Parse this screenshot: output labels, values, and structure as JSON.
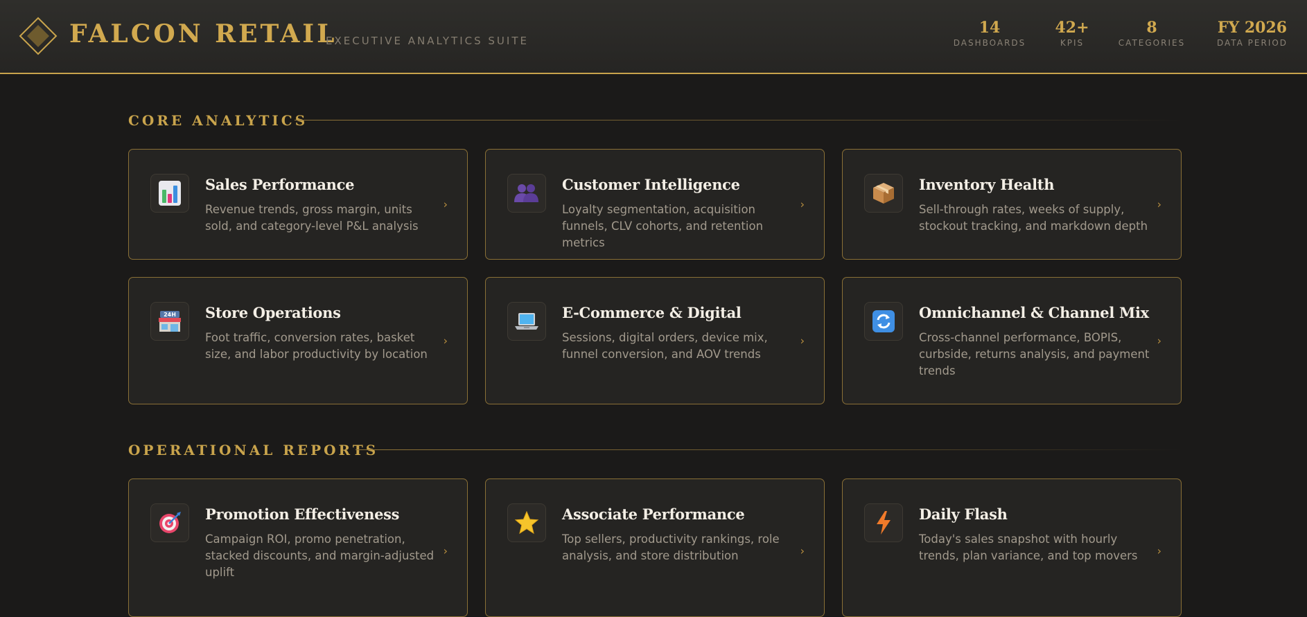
{
  "header": {
    "brand": "FALCON RETAIL",
    "subtitle": "EXECUTIVE ANALYTICS SUITE",
    "stats": [
      {
        "value": "14",
        "label": "DASHBOARDS"
      },
      {
        "value": "42+",
        "label": "KPIS"
      },
      {
        "value": "8",
        "label": "CATEGORIES"
      },
      {
        "value": "FY 2026",
        "label": "DATA PERIOD"
      }
    ]
  },
  "sections": [
    {
      "title": "CORE ANALYTICS",
      "cards": [
        {
          "icon": "bar-chart-icon",
          "title": "Sales Performance",
          "desc": "Revenue trends, gross margin, units sold, and category-level P&L analysis"
        },
        {
          "icon": "people-icon",
          "title": "Customer Intelligence",
          "desc": "Loyalty segmentation, acquisition funnels, CLV cohorts, and retention metrics"
        },
        {
          "icon": "package-icon",
          "title": "Inventory Health",
          "desc": "Sell-through rates, weeks of supply, stockout tracking, and markdown depth"
        },
        {
          "icon": "store-icon",
          "title": "Store Operations",
          "desc": "Foot traffic, conversion rates, basket size, and labor productivity by location"
        },
        {
          "icon": "laptop-icon",
          "title": "E-Commerce & Digital",
          "desc": "Sessions, digital orders, device mix, funnel conversion, and AOV trends"
        },
        {
          "icon": "refresh-icon",
          "title": "Omnichannel & Channel Mix",
          "desc": "Cross-channel performance, BOPIS, curbside, returns analysis, and payment trends"
        }
      ]
    },
    {
      "title": "OPERATIONAL REPORTS",
      "cards": [
        {
          "icon": "target-icon",
          "title": "Promotion Effectiveness",
          "desc": "Campaign ROI, promo penetration, stacked discounts, and margin-adjusted uplift"
        },
        {
          "icon": "star-icon",
          "title": "Associate Performance",
          "desc": "Top sellers, productivity rankings, role analysis, and store distribution"
        },
        {
          "icon": "lightning-icon",
          "title": "Daily Flash",
          "desc": "Today's sales snapshot with hourly trends, plan variance, and top movers"
        }
      ]
    }
  ],
  "chevron": "›",
  "colors": {
    "accent": "#c9a44c",
    "background": "#1b1a19",
    "card": "#252422"
  }
}
